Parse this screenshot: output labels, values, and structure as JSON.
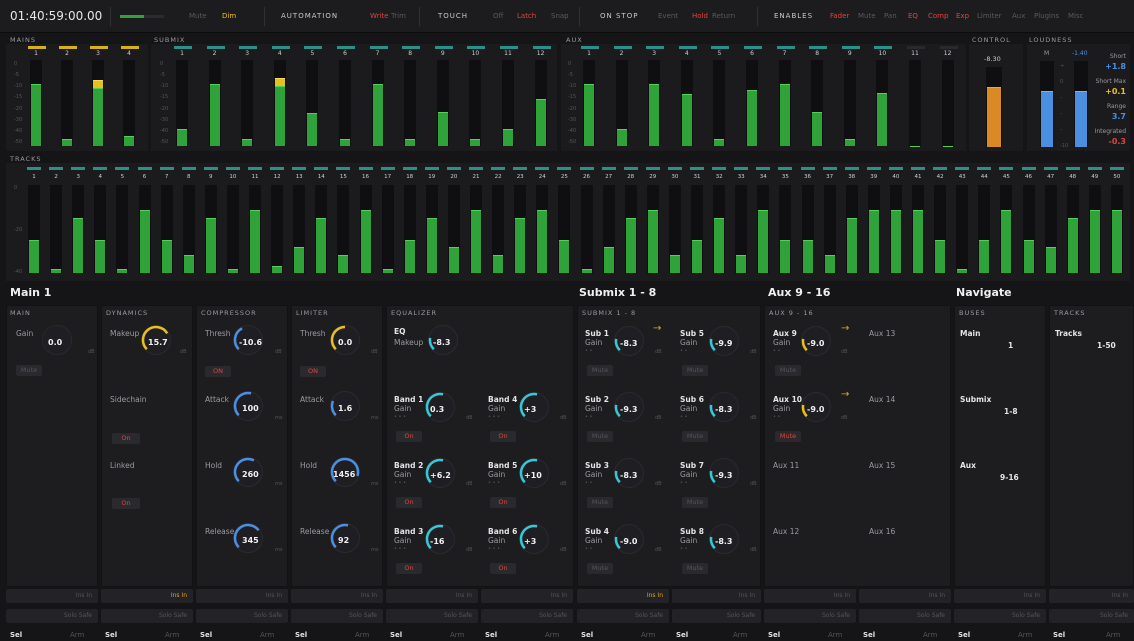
{
  "topbar": {
    "timecode": "01:40:59:00.00",
    "mute": "Mute",
    "dim": "Dim",
    "automation": {
      "label": "AUTOMATION",
      "write": "Write",
      "trim": "Trim"
    },
    "touch": {
      "label": "TOUCH",
      "off": "Off",
      "latch": "Latch",
      "snap": "Snap"
    },
    "onstop": {
      "label": "ON STOP",
      "event": "Event",
      "hold": "Hold",
      "return": "Return"
    },
    "enables": {
      "label": "ENABLES",
      "fader": "Fader",
      "mute": "Mute",
      "pan": "Pan",
      "eq": "EQ",
      "comp": "Comp",
      "exp": "Exp",
      "limiter": "Limiter",
      "aux": "Aux",
      "plugins": "Plugins",
      "misc": "Misc"
    }
  },
  "meters": {
    "mains_label": "MAINS",
    "submix_label": "SUBMIX",
    "aux_label": "AUX",
    "control_label": "CONTROL",
    "loudness_label": "LOUDNESS",
    "tracks_label": "TRACKS",
    "mains": [
      "1",
      "2",
      "3",
      "4"
    ],
    "submix": [
      "1",
      "2",
      "3",
      "4",
      "5",
      "6",
      "7",
      "8",
      "9",
      "10",
      "11",
      "12"
    ],
    "aux": [
      "1",
      "2",
      "3",
      "4",
      "5",
      "6",
      "7",
      "8",
      "9",
      "10",
      "11",
      "12"
    ],
    "scale": [
      "0",
      "-5",
      "-10",
      "-15",
      "-20",
      "-30",
      "-40",
      "-50"
    ],
    "control_value": "-8.30",
    "loudness": {
      "m_label": "M",
      "m_value": "-1.40",
      "short_label": "Short",
      "short_value": "+1.8",
      "shortmax_label": "Short Max",
      "shortmax_value": "+0.1",
      "range_label": "Range",
      "range_value": "3.7",
      "integrated_label": "Integrated",
      "integrated_value": "-0.3",
      "scale": [
        "+",
        "0",
        "-",
        "-",
        "-",
        "-10"
      ]
    },
    "tracks": [
      "1",
      "2",
      "3",
      "4",
      "5",
      "6",
      "7",
      "8",
      "9",
      "10",
      "11",
      "12",
      "13",
      "14",
      "15",
      "16",
      "17",
      "18",
      "19",
      "20",
      "21",
      "22",
      "23",
      "24",
      "25",
      "26",
      "27",
      "28",
      "29",
      "30",
      "31",
      "32",
      "33",
      "34",
      "35",
      "36",
      "37",
      "38",
      "39",
      "40",
      "41",
      "42",
      "43",
      "44",
      "45",
      "46",
      "47",
      "48",
      "49",
      "50"
    ],
    "track_scale": [
      "0",
      "-20",
      "-40"
    ]
  },
  "sections": {
    "main": "Main 1",
    "submix": "Submix 1 - 8",
    "aux": "Aux 9 - 16",
    "navigate": "Navigate"
  },
  "main": {
    "col_main": "MAIN",
    "col_dynamics": "DYNAMICS",
    "col_compressor": "COMPRESSOR",
    "col_limiter": "LIMITER",
    "col_equalizer": "EQUALIZER",
    "gain_label": "Gain",
    "gain_value": "0.0",
    "unit_db": "dB",
    "mute": "Mute",
    "makeup_label": "Makeup",
    "makeup_value": "15.7",
    "sidechain_label": "Sidechain",
    "sidechain_btn": "On",
    "linked_label": "Linked",
    "linked_btn": "On",
    "comp": {
      "thresh_label": "Thresh",
      "thresh_value": "-10.6",
      "on": "ON",
      "attack_label": "Attack",
      "attack_value": "100",
      "unit_ms": "ms",
      "hold_label": "Hold",
      "hold_value": "260",
      "release_label": "Release",
      "release_value": "345"
    },
    "limiter": {
      "thresh_label": "Thresh",
      "thresh_value": "0.0",
      "on": "ON",
      "attack_label": "Attack",
      "attack_value": "1.6",
      "hold_label": "Hold",
      "hold_value": "1456",
      "release_label": "Release",
      "release_value": "92"
    },
    "eq": {
      "eq_label": "EQ",
      "makeup_label": "Makeup",
      "makeup_value": "-8.3",
      "bands": [
        {
          "name": "Band 1",
          "gain_label": "Gain",
          "value": "0.3",
          "btn": "On"
        },
        {
          "name": "Band 4",
          "gain_label": "Gain",
          "value": "+3",
          "btn": "On"
        },
        {
          "name": "Band 2",
          "gain_label": "Gain",
          "value": "+6.2",
          "btn": "On"
        },
        {
          "name": "Band 5",
          "gain_label": "Gain",
          "value": "+10",
          "btn": "On"
        },
        {
          "name": "Band 3",
          "gain_label": "Gain",
          "value": "-16",
          "btn": "On"
        },
        {
          "name": "Band 6",
          "gain_label": "Gain",
          "value": "+3",
          "btn": "On"
        }
      ]
    }
  },
  "submix": {
    "col": "SUBMIX 1 - 8",
    "items": [
      {
        "name": "Sub 1",
        "gain_label": "Gain",
        "value": "-8.3",
        "btn": "Mute"
      },
      {
        "name": "Sub 5",
        "gain_label": "Gain",
        "value": "-9.9",
        "btn": "Mute"
      },
      {
        "name": "Sub 2",
        "gain_label": "Gain",
        "value": "-9.3",
        "btn": "Mute"
      },
      {
        "name": "Sub 6",
        "gain_label": "Gain",
        "value": "-8.3",
        "btn": "Mute"
      },
      {
        "name": "Sub 3",
        "gain_label": "Gain",
        "value": "-8.3",
        "btn": "Mute"
      },
      {
        "name": "Sub 7",
        "gain_label": "Gain",
        "value": "-9.3",
        "btn": "Mute"
      },
      {
        "name": "Sub 4",
        "gain_label": "Gain",
        "value": "-9.0",
        "btn": "Mute"
      },
      {
        "name": "Sub 8",
        "gain_label": "Gain",
        "value": "-8.3",
        "btn": "Mute"
      }
    ]
  },
  "aux": {
    "col": "AUX 9 - 16",
    "items": [
      {
        "name": "Aux 9",
        "gain_label": "Gain",
        "value": "-9.0",
        "btn": "Mute"
      },
      {
        "name": "Aux 13"
      },
      {
        "name": "Aux 10",
        "gain_label": "Gain",
        "value": "-9.0",
        "btn": "Mute"
      },
      {
        "name": "Aux 14"
      },
      {
        "name": "Aux 11"
      },
      {
        "name": "Aux 15"
      },
      {
        "name": "Aux 12"
      },
      {
        "name": "Aux 16"
      }
    ]
  },
  "navigate": {
    "col_buses": "BUSES",
    "col_tracks": "TRACKS",
    "main_label": "Main",
    "main_value": "1",
    "submix_label": "Submix",
    "submix_value": "1-8",
    "aux_label": "Aux",
    "aux_value": "9-16",
    "tracks_label": "Tracks",
    "tracks_value": "1-50"
  },
  "footer": {
    "insin": "Ins In",
    "solosafe": "Solo Safe",
    "sel": "Sel",
    "arm": "Arm"
  },
  "colors": {
    "accent_red": "#e0443a",
    "accent_yellow": "#e8c01d",
    "meter_green": "#2fa33a",
    "meter_blue": "#4a8fe0",
    "meter_orange": "#d98a25"
  }
}
